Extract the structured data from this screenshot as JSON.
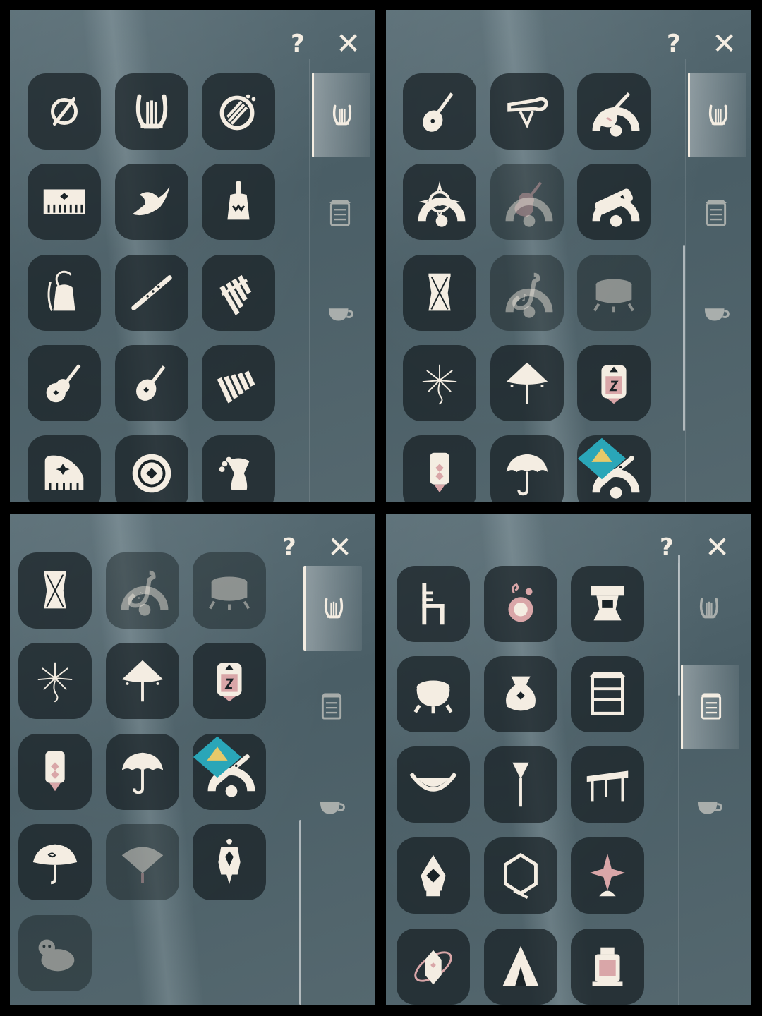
{
  "controls": {
    "help_glyph": "?",
    "close_glyph": "✕"
  },
  "colors": {
    "icon": "#f4ede2",
    "accent_pink": "#d9a6a8",
    "tile": "#1a2327",
    "frame": "#000000"
  },
  "side_tabs": [
    "lyre-icon",
    "cabinet-icon",
    "teacup-icon"
  ],
  "panels": [
    {
      "id": "top-left",
      "active_tab": "lyre-icon",
      "items": [
        {
          "icon": "none-icon"
        },
        {
          "icon": "lyre-icon"
        },
        {
          "icon": "harp-circle-icon"
        },
        {
          "icon": "keyboard-icon"
        },
        {
          "icon": "horn-icon"
        },
        {
          "icon": "handbell-icon"
        },
        {
          "icon": "bell-icon"
        },
        {
          "icon": "flute-icon"
        },
        {
          "icon": "panflute-icon"
        },
        {
          "icon": "guitar-icon"
        },
        {
          "icon": "mandolin-icon"
        },
        {
          "icon": "xylophone-icon"
        },
        {
          "icon": "piano-icon"
        },
        {
          "icon": "drum-round-icon"
        },
        {
          "icon": "djembe-icon"
        }
      ]
    },
    {
      "id": "top-right",
      "active_tab": "lyre-icon",
      "items": [
        {
          "icon": "pipa-icon"
        },
        {
          "icon": "trumpet-icon"
        },
        {
          "icon": "electric-guitar-icon",
          "locked": true
        },
        {
          "icon": "star-compass-icon",
          "locked": true
        },
        {
          "icon": "violin-icon",
          "locked": true,
          "dim": true
        },
        {
          "icon": "harmonica-icon",
          "locked": true
        },
        {
          "icon": "hand-drum-icon"
        },
        {
          "icon": "saxophone-icon",
          "locked": true,
          "dim": true
        },
        {
          "icon": "big-drum-icon",
          "dim": true
        },
        {
          "icon": "firework-icon"
        },
        {
          "icon": "straw-hat-umbrella-icon"
        },
        {
          "icon": "lantern-box-icon"
        },
        {
          "icon": "lantern-small-icon"
        },
        {
          "icon": "umbrella-icon"
        },
        {
          "icon": "flute-icon",
          "locked": true,
          "new": true
        }
      ]
    },
    {
      "id": "bottom-left",
      "active_tab": "lyre-icon",
      "items": [
        {
          "icon": "hand-drum-icon"
        },
        {
          "icon": "saxophone-icon",
          "locked": true,
          "dim": true
        },
        {
          "icon": "big-drum-icon",
          "dim": true
        },
        {
          "icon": "firework-icon"
        },
        {
          "icon": "straw-hat-umbrella-icon"
        },
        {
          "icon": "lantern-box-icon"
        },
        {
          "icon": "lantern-small-icon"
        },
        {
          "icon": "umbrella-icon"
        },
        {
          "icon": "flute-icon",
          "locked": true,
          "new": true
        },
        {
          "icon": "swirl-umbrella-icon"
        },
        {
          "icon": "fan-icon",
          "dim": true
        },
        {
          "icon": "hanging-lantern-icon"
        },
        {
          "icon": "plush-animal-icon",
          "dim": true
        }
      ]
    },
    {
      "id": "bottom-right",
      "active_tab": "cabinet-icon",
      "items": [
        {
          "icon": "chair-icon"
        },
        {
          "icon": "potion-icon"
        },
        {
          "icon": "stool-icon"
        },
        {
          "icon": "cauldron-icon"
        },
        {
          "icon": "sack-icon"
        },
        {
          "icon": "shelf-icon"
        },
        {
          "icon": "hammock-icon"
        },
        {
          "icon": "broom-icon"
        },
        {
          "icon": "table-icon"
        },
        {
          "icon": "pinecone-lamp-icon"
        },
        {
          "icon": "hex-frame-icon"
        },
        {
          "icon": "star-lamp-icon"
        },
        {
          "icon": "orbit-crystal-icon"
        },
        {
          "icon": "tent-icon"
        },
        {
          "icon": "cage-lantern-icon"
        }
      ]
    }
  ]
}
